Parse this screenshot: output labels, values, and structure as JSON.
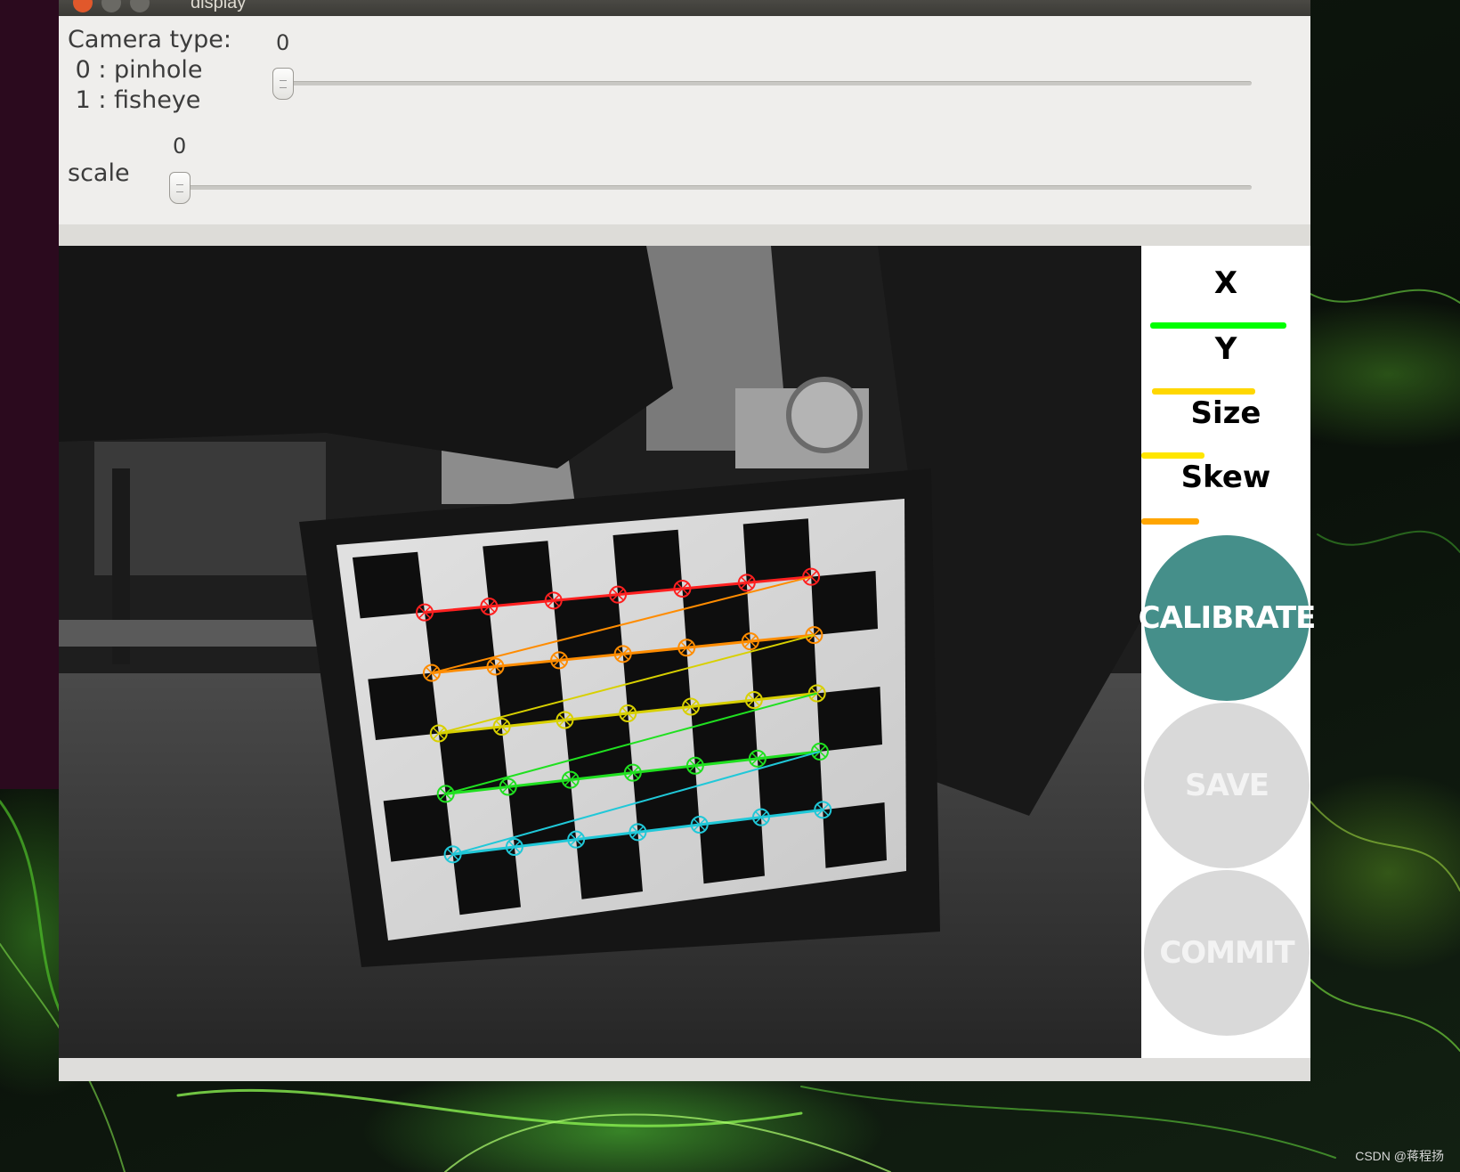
{
  "window": {
    "title": "display"
  },
  "controls": {
    "camera_type": {
      "label": "Camera type:\n 0 : pinhole\n 1 : fisheye",
      "value": "0"
    },
    "scale": {
      "label": "scale",
      "value": "0"
    }
  },
  "sidebar": {
    "metrics": [
      {
        "label": "X",
        "bar_fraction": 0.9,
        "color": "#00ff00"
      },
      {
        "label": "Y",
        "bar_fraction": 0.68,
        "color": "#ffd700"
      },
      {
        "label": "Size",
        "bar_fraction": 0.42,
        "color": "#ffe600"
      },
      {
        "label": "Skew",
        "bar_fraction": 0.38,
        "color": "#ffa500"
      }
    ],
    "buttons": [
      {
        "label": "CALIBRATE",
        "state": "enabled",
        "color": "#458f8a"
      },
      {
        "label": "SAVE",
        "state": "disabled",
        "color": "#d9d9d9"
      },
      {
        "label": "COMMIT",
        "state": "disabled",
        "color": "#d9d9d9"
      }
    ]
  },
  "detection": {
    "row_colors": [
      "#ff2020",
      "#ff8c00",
      "#d8d000",
      "#20e020",
      "#20c8d8"
    ],
    "corners_per_row": 7,
    "rows": 5
  },
  "desktop": {
    "caption": "CSDN @蒋程扬"
  }
}
